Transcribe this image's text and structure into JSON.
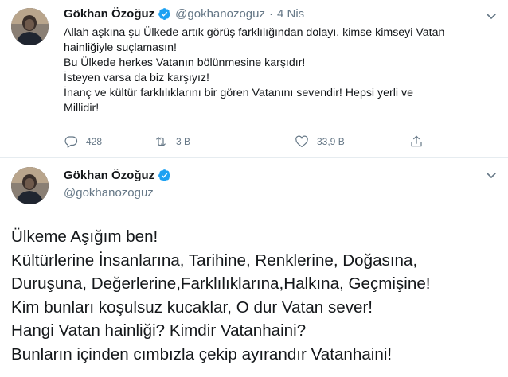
{
  "tweet1": {
    "author_name": "Gökhan Özoğuz",
    "handle": "@gokhanozoguz",
    "separator": "·",
    "time": "4 Nis",
    "lines": [
      "Allah aşkına şu Ülkede artık görüş farklılığından dolayı, kimse kimseyi Vatan",
      "hainliğiyle suçlamasın!",
      "Bu Ülkede herkes Vatanın bölünmesine karşıdır!",
      "İsteyen varsa da biz karşıyız!",
      "İnanç ve kültür farklılıklarını bir gören Vatanını sevendir! Hepsi yerli ve",
      "Millidir!"
    ],
    "replies": "428",
    "retweets": "3 B",
    "likes": "33,9 B",
    "icons": {
      "avatar": "profile-photo",
      "verified": "verified-badge-icon",
      "more": "chevron-down-icon",
      "reply": "reply-icon",
      "retweet": "retweet-icon",
      "like": "heart-icon",
      "share": "share-icon"
    }
  },
  "tweet2": {
    "author_name": "Gökhan Özoğuz",
    "handle": "@gokhanozoguz",
    "lines": [
      "Ülkeme Aşığım ben!",
      "Kültürlerine İnsanlarına, Tarihine, Renklerine, Doğasına,",
      "Duruşuna, Değerlerine,Farklılıklarına,Halkına, Geçmişine!",
      "Kim bunları koşulsuz kucaklar, O dur Vatan sever!",
      "Hangi Vatan hainliği? Kimdir Vatanhaini?",
      "Bunların içinden cımbızla çekip ayırandır Vatanhaini!"
    ]
  },
  "colors": {
    "text": "#14171a",
    "secondary": "#657786",
    "verified": "#1da1f2",
    "divider": "#e6ecf0"
  }
}
